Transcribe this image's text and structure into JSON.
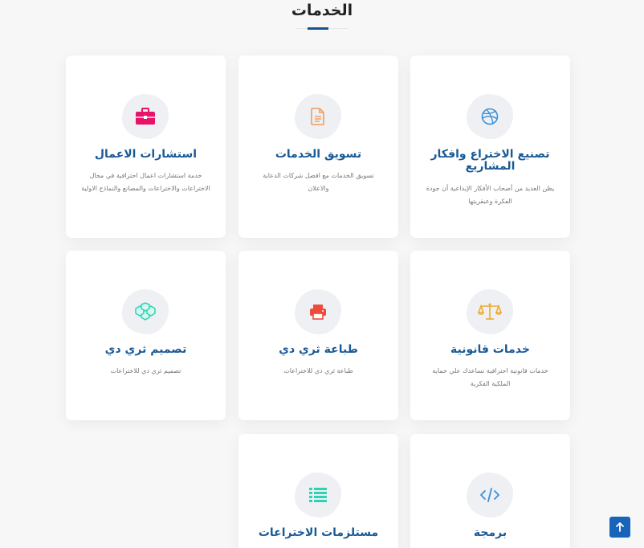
{
  "section": {
    "title": "الخدمات"
  },
  "services": [
    {
      "title": "استشارات الاعمال",
      "description": "خدمة استشارات اعمال احترافية في مجال الاختراعات والاختراعات والمصانع والنماذج الاولية",
      "icon": "briefcase-icon",
      "color": "#e8126b"
    },
    {
      "title": "تسويق الخدمات",
      "description": "تسويق الخدمات مع افضل شركات الدعاية والاعلان",
      "icon": "document-icon",
      "color": "#f39c5c"
    },
    {
      "title": "تصنيع الاختراع وافكار المشاريع",
      "description": "يظن العديد من أصحاب الأفكار الإبداعية أن جودة الفكرة وعبقريتها",
      "icon": "dribbble-icon",
      "color": "#3b8fd9"
    },
    {
      "title": "تصميم ثري دي",
      "description": "تصميم ثري دي للاختراعات",
      "icon": "cubes-icon",
      "color": "#2ed3b5"
    },
    {
      "title": "طباعة ثري دي",
      "description": "طباعة ثري دي للاختراعات",
      "icon": "printer-icon",
      "color": "#ee4b3a"
    },
    {
      "title": "خدمات قانونية",
      "description": "خدمات قانونية احترافية تساعدك علي حماية الملكية الفكرية",
      "icon": "scale-icon",
      "color": "#f0ab2c"
    },
    {
      "title": "مستلزمات الاختراعات",
      "description": "",
      "icon": "list-icon",
      "color": "#2ed3b5"
    },
    {
      "title": "برمجة",
      "description": "",
      "icon": "code-icon",
      "color": "#3b8fd9"
    }
  ]
}
